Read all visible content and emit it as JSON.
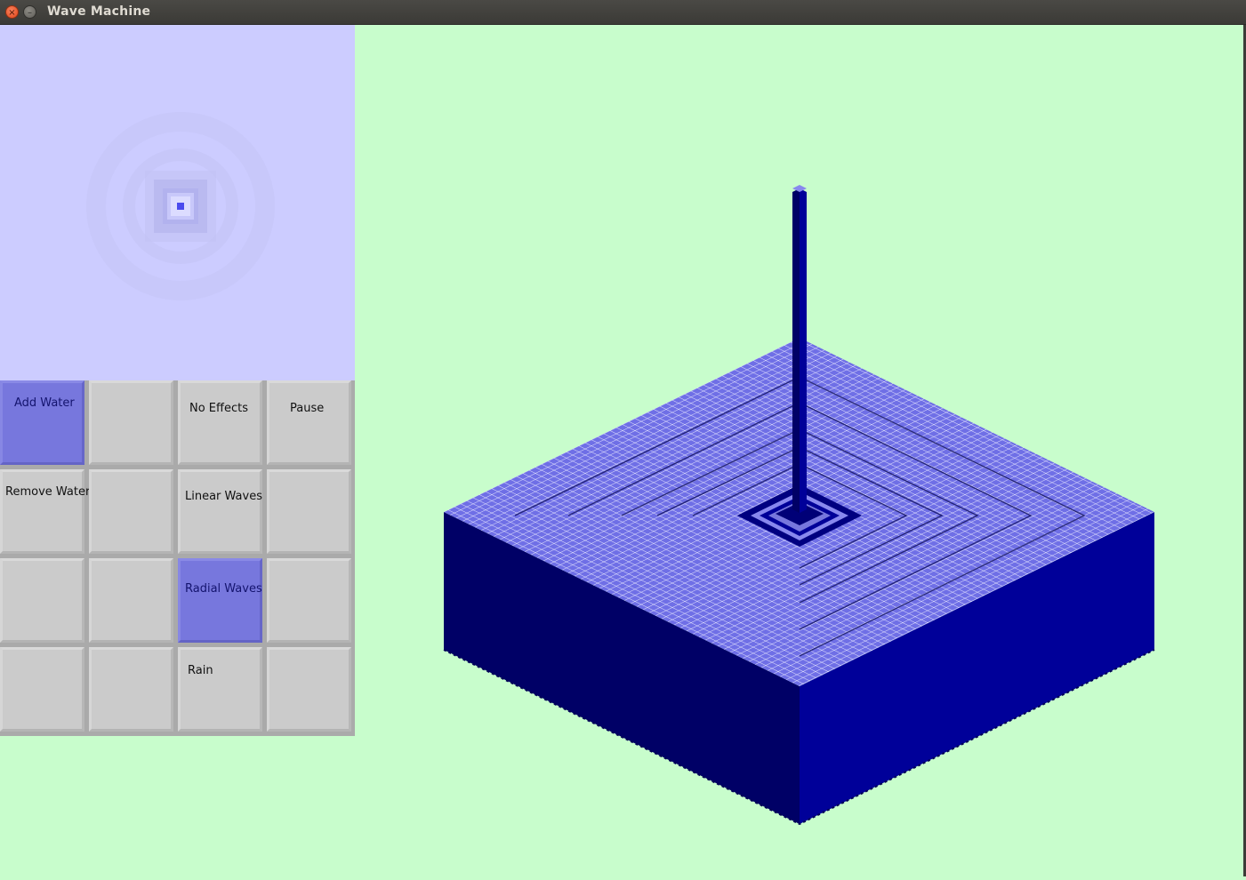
{
  "window": {
    "title": "Wave Machine",
    "close_glyph": "×",
    "minimize_glyph": "–"
  },
  "colors": {
    "background": "#c8fdcc",
    "minimap_water": "#ccccff",
    "water_top": "#8888ee",
    "water_side_left": "#000066",
    "water_side_right": "#000099",
    "button_idle": "#cbcbcb",
    "button_active": "#7777dd"
  },
  "buttons": [
    {
      "label": "Add Water",
      "active": true
    },
    {
      "label": "",
      "active": false
    },
    {
      "label": "No Effects",
      "active": false
    },
    {
      "label": "Pause",
      "active": false
    },
    {
      "label": "Remove Water",
      "active": false
    },
    {
      "label": "",
      "active": false
    },
    {
      "label": "Linear Waves",
      "active": false
    },
    {
      "label": "",
      "active": false
    },
    {
      "label": "",
      "active": false
    },
    {
      "label": "",
      "active": false
    },
    {
      "label": "Radial Waves",
      "active": true
    },
    {
      "label": "",
      "active": false
    },
    {
      "label": "",
      "active": false
    },
    {
      "label": "",
      "active": false
    },
    {
      "label": "Rain",
      "active": false
    },
    {
      "label": "",
      "active": false
    }
  ]
}
